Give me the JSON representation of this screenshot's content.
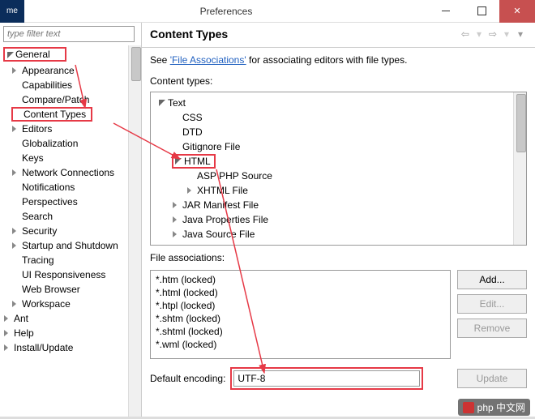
{
  "titlebar": {
    "app_badge": "me",
    "title": "Preferences"
  },
  "filter": {
    "placeholder": "type filter text"
  },
  "left_tree": {
    "general": "General",
    "items": [
      "Appearance",
      "Capabilities",
      "Compare/Patch",
      "Content Types",
      "Editors",
      "Globalization",
      "Keys",
      "Network Connections",
      "Notifications",
      "Perspectives",
      "Search",
      "Security",
      "Startup and Shutdown",
      "Tracing",
      "UI Responsiveness",
      "Web Browser",
      "Workspace"
    ],
    "ant": "Ant",
    "help": "Help",
    "install": "Install/Update"
  },
  "right": {
    "heading": "Content Types",
    "intro_prefix": "See ",
    "intro_link": "'File Associations'",
    "intro_suffix": " for associating editors with file types.",
    "content_types_label": "Content types:",
    "tree": {
      "text": "Text",
      "css": "CSS",
      "dtd": "DTD",
      "gitignore": "Gitignore File",
      "html": "HTML",
      "asp_php": "ASP PHP Source",
      "xhtml": "XHTML File",
      "jar": "JAR Manifest File",
      "javaprops": "Java Properties File",
      "javasrc": "Java Source File"
    },
    "file_assoc_label": "File associations:",
    "file_assoc": [
      "*.htm (locked)",
      "*.html (locked)",
      "*.htpl (locked)",
      "*.shtm (locked)",
      "*.shtml (locked)",
      "*.wml (locked)"
    ],
    "buttons": {
      "add": "Add...",
      "edit": "Edit...",
      "remove": "Remove",
      "update": "Update"
    },
    "encoding_label": "Default encoding:",
    "encoding_value": "UTF-8"
  },
  "watermark": "php 中文网"
}
